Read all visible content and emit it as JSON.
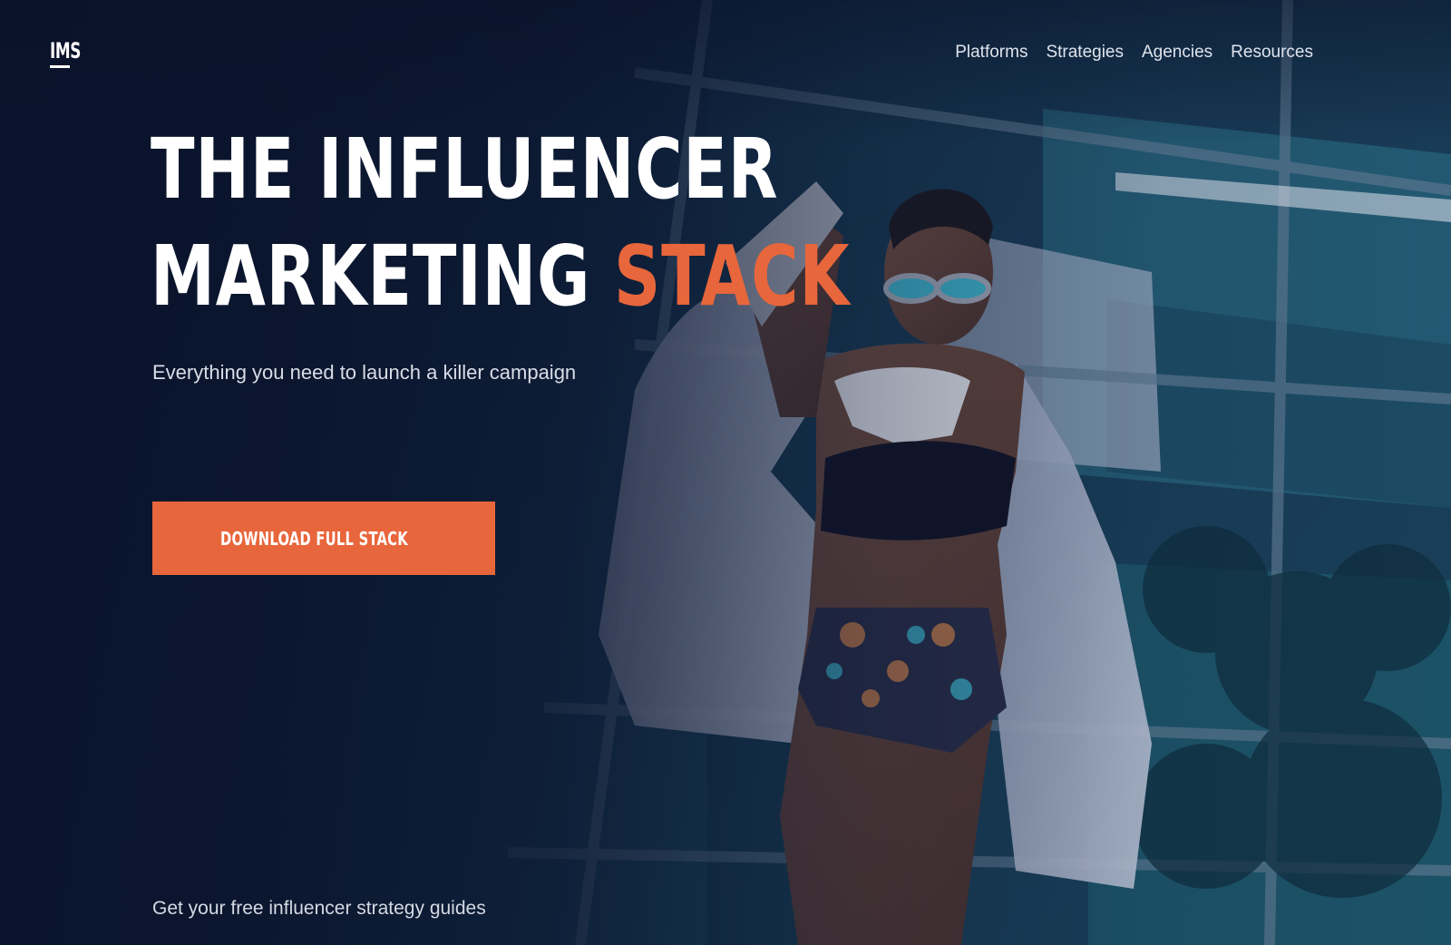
{
  "brand": {
    "logo_text": "IMS"
  },
  "nav": {
    "items": [
      "Platforms",
      "Strategies",
      "Agencies",
      "Resources"
    ]
  },
  "hero": {
    "title_line1": "THE INFLUENCER",
    "title_line2_main": "MARKETING",
    "title_line2_accent": "STACK",
    "subtitle": "Everything you need to launch a killer campaign",
    "cta_label": "DOWNLOAD FULL STACK",
    "footnote": "Get your free influencer strategy guides"
  },
  "colors": {
    "accent": "#e8663b",
    "background": "#0b1630",
    "text": "#ffffff",
    "muted_text": "#d9dde7"
  }
}
